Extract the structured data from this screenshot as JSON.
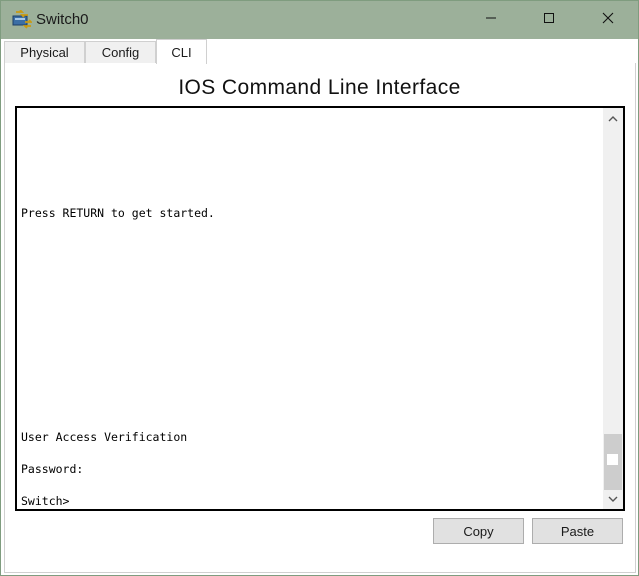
{
  "window": {
    "title": "Switch0",
    "icon": "cisco-switch-icon"
  },
  "titlebar_controls": {
    "minimize_icon": "minimize-icon",
    "maximize_icon": "maximize-icon",
    "close_icon": "close-icon"
  },
  "tabs": [
    {
      "label": "Physical",
      "active": false
    },
    {
      "label": "Config",
      "active": false
    },
    {
      "label": "CLI",
      "active": true
    }
  ],
  "cli": {
    "heading": "IOS Command Line Interface",
    "lines": [
      "Press RETURN to get started.",
      "User Access Verification",
      "Password:",
      "Switch>"
    ]
  },
  "buttons": {
    "copy_label": "Copy",
    "paste_label": "Paste"
  },
  "colors": {
    "titlebar": "#9cb09a",
    "terminal_border": "#000000"
  }
}
